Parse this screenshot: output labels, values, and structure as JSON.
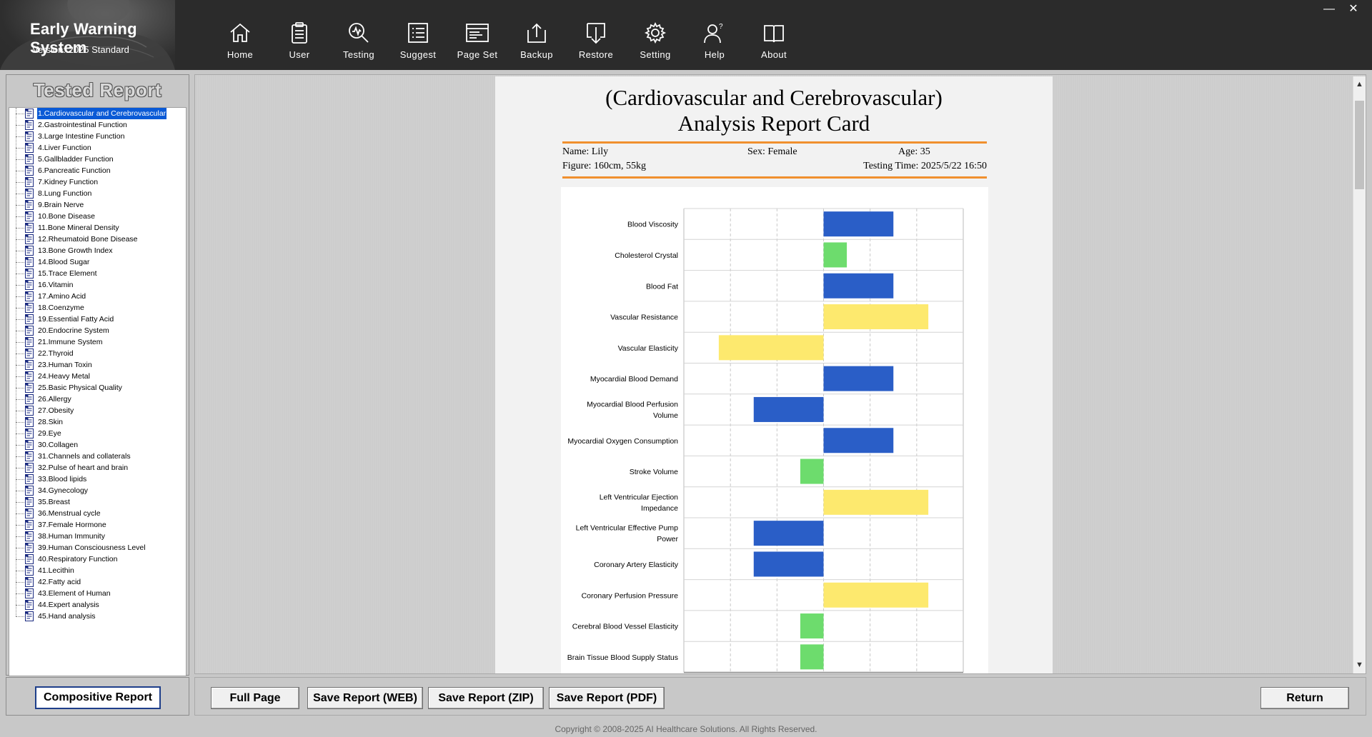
{
  "app": {
    "title": "Early Warning System",
    "version": "Version: 2025 Standard"
  },
  "toolbar": [
    {
      "label": "Home",
      "icon": "home-icon"
    },
    {
      "label": "User",
      "icon": "clipboard-icon"
    },
    {
      "label": "Testing",
      "icon": "magnifier-icon"
    },
    {
      "label": "Suggest",
      "icon": "list-icon"
    },
    {
      "label": "Page Set",
      "icon": "page-settings-icon"
    },
    {
      "label": "Backup",
      "icon": "upload-icon"
    },
    {
      "label": "Restore",
      "icon": "download-icon"
    },
    {
      "label": "Setting",
      "icon": "gear-icon"
    },
    {
      "label": "Help",
      "icon": "help-person-icon"
    },
    {
      "label": "About",
      "icon": "book-icon"
    }
  ],
  "window_controls": {
    "minimize": "—",
    "close": "✕"
  },
  "left_panel": {
    "title": "Tested Report",
    "selected_index": 0,
    "items": [
      "1.Cardiovascular and Cerebrovascular",
      "2.Gastrointestinal Function",
      "3.Large Intestine Function",
      "4.Liver Function",
      "5.Gallbladder Function",
      "6.Pancreatic Function",
      "7.Kidney Function",
      "8.Lung Function",
      "9.Brain Nerve",
      "10.Bone Disease",
      "11.Bone Mineral Density",
      "12.Rheumatoid Bone Disease",
      "13.Bone Growth Index",
      "14.Blood Sugar",
      "15.Trace Element",
      "16.Vitamin",
      "17.Amino Acid",
      "18.Coenzyme",
      "19.Essential Fatty Acid",
      "20.Endocrine System",
      "21.Immune System",
      "22.Thyroid",
      "23.Human Toxin",
      "24.Heavy Metal",
      "25.Basic Physical Quality",
      "26.Allergy",
      "27.Obesity",
      "28.Skin",
      "29.Eye",
      "30.Collagen",
      "31.Channels and collaterals",
      "32.Pulse of heart and brain",
      "33.Blood lipids",
      "34.Gynecology",
      "35.Breast",
      "36.Menstrual cycle",
      "37.Female Hormone",
      "38.Human Immunity",
      "39.Human Consciousness Level",
      "40.Respiratory Function",
      "41.Lecithin",
      "42.Fatty acid",
      "43.Element of Human",
      "44.Expert analysis",
      "45.Hand analysis"
    ],
    "compositive_button": "Compositive Report"
  },
  "report": {
    "title_line1": "(Cardiovascular and Cerebrovascular)",
    "title_line2": "Analysis Report Card",
    "name": "Name: Lily",
    "sex": "Sex: Female",
    "age": "Age: 35",
    "figure": "Figure: 160cm, 55kg",
    "testing_time": "Testing Time: 2025/5/22 16:50"
  },
  "chart_data": {
    "type": "bar",
    "orientation": "horizontal",
    "grid": true,
    "xlim": [
      -3,
      3
    ],
    "xticks": [
      -3,
      -2,
      -1,
      0,
      1,
      2,
      3
    ],
    "colors": {
      "blue": "#2a5ec7",
      "green": "#6ddc6d",
      "yellow": "#fde96e"
    },
    "categories": [
      "Blood Viscosity",
      "Cholesterol Crystal",
      "Blood Fat",
      "Vascular Resistance",
      "Vascular Elasticity",
      "Myocardial Blood Demand",
      "Myocardial Blood Perfusion Volume",
      "Myocardial Oxygen Consumption",
      "Stroke Volume",
      "Left Ventricular Ejection Impedance",
      "Left Ventricular Effective Pump Power",
      "Coronary Artery Elasticity",
      "Coronary Perfusion Pressure",
      "Cerebral Blood Vessel Elasticity",
      "Brain Tissue Blood Supply Status"
    ],
    "values": [
      1.5,
      0.5,
      1.5,
      2.25,
      -2.25,
      1.5,
      -1.5,
      1.5,
      -0.5,
      2.25,
      -1.5,
      -1.5,
      2.25,
      -0.5,
      -0.5
    ],
    "bar_colors": [
      "blue",
      "green",
      "blue",
      "yellow",
      "yellow",
      "blue",
      "blue",
      "blue",
      "green",
      "yellow",
      "blue",
      "blue",
      "yellow",
      "green",
      "green"
    ]
  },
  "bottom_buttons": {
    "full_page": "Full Page",
    "save_web": "Save Report (WEB)",
    "save_zip": "Save Report (ZIP)",
    "save_pdf": "Save Report (PDF)",
    "return": "Return"
  },
  "footer": "Copyright © 2008-2025 AI Healthcare Solutions. All Rights Reserved."
}
